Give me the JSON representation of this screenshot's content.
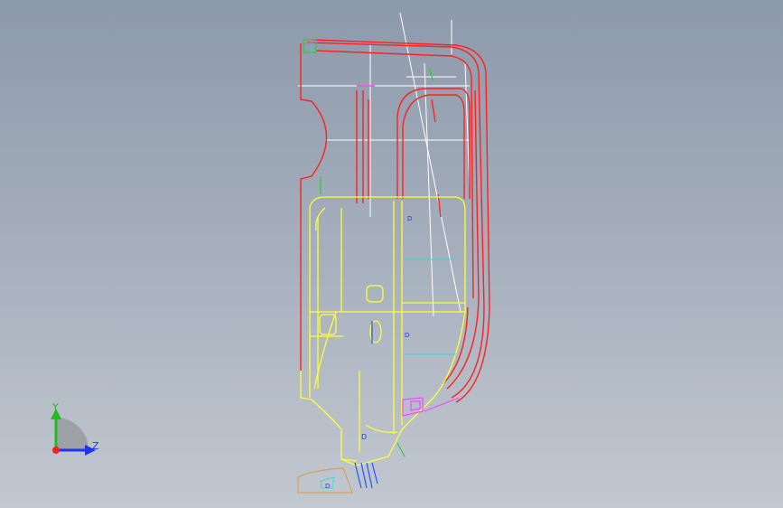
{
  "viewport": {
    "background_top": "#8d9aab",
    "background_bottom": "#c2c8d0"
  },
  "model": {
    "colors": {
      "frame": "#ff2020",
      "panel": "#ffff33",
      "construction": "#ffffff",
      "highlight": "#ff44ff",
      "accent_cyan": "#33dddd",
      "accent_blue": "#2255ff",
      "accent_green": "#33cc33",
      "accent_orange": "#dd9944"
    },
    "markers": [
      "D",
      "D",
      "D",
      "D"
    ]
  },
  "triad": {
    "y_label": "Y",
    "z_label": "Z",
    "icon": "coordinate-triad-icon",
    "y_color": "#22bb22",
    "z_color": "#2233ee",
    "x_color": "#ee2222"
  }
}
